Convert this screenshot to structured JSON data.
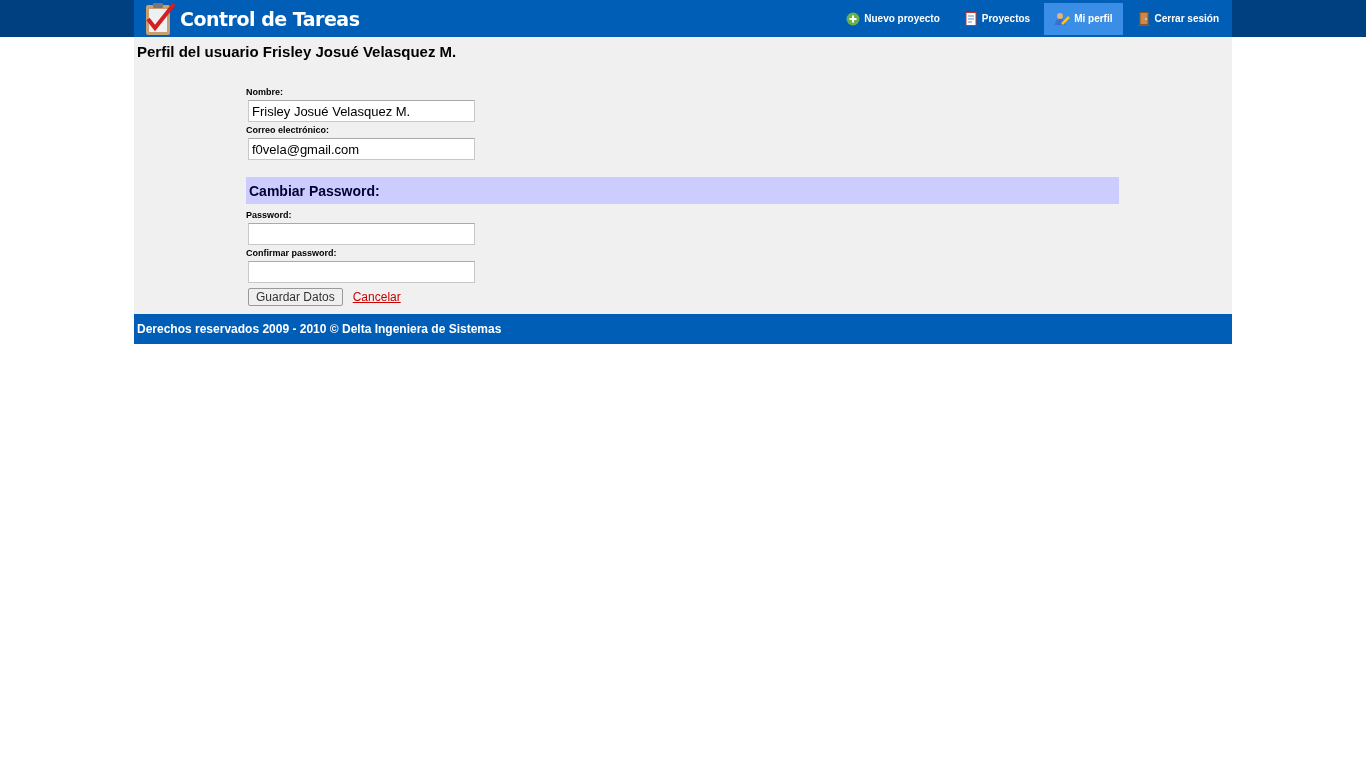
{
  "header": {
    "logo": "Control de Tareas",
    "nav": [
      {
        "label": "Nuevo proyecto",
        "kind": "new",
        "selected": false
      },
      {
        "label": "Proyectos",
        "kind": "projects",
        "selected": false
      },
      {
        "label": "Mi perfil",
        "kind": "profile",
        "selected": true
      },
      {
        "label": "Cerrar sesión",
        "kind": "logout",
        "selected": false
      }
    ]
  },
  "page_title": "Perfil del usuario Frisley Josué Velasquez M.",
  "fields": [
    {
      "label": "Nombre:",
      "value": "Frisley Josué Velasquez M."
    },
    {
      "label": "Correo electrónico:",
      "value": "f0vela@gmail.com"
    }
  ],
  "password_section": {
    "title": "Cambiar Password:",
    "fields": [
      {
        "label": "Password:"
      },
      {
        "label": "Confirmar password:"
      }
    ]
  },
  "buttons": {
    "save": "Guardar Datos",
    "cancel": "Cancelar"
  },
  "footer": "Derechos reservados 2009 - 2010 © Delta Ingeniera de Sistemas"
}
